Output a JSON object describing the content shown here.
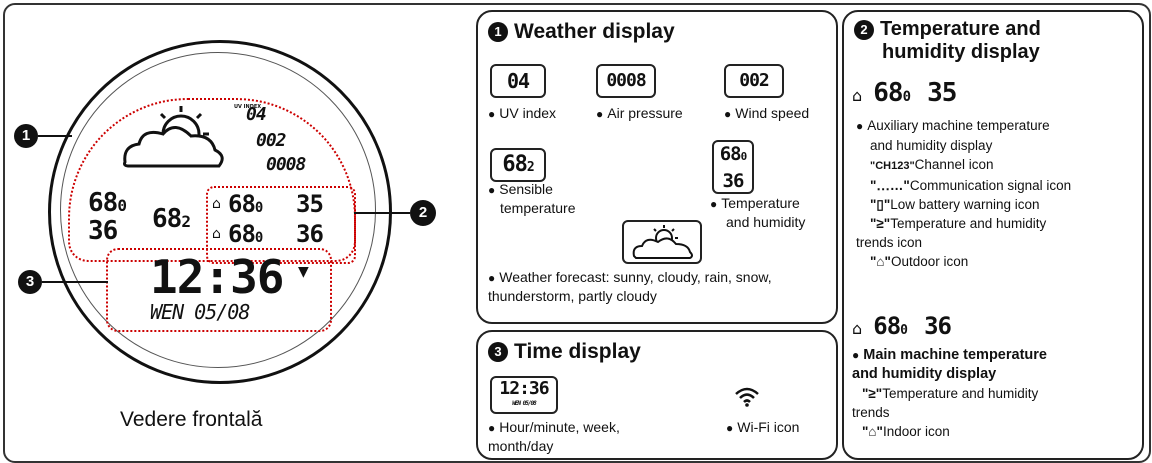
{
  "caption": "Vedere frontală",
  "callouts": [
    "1",
    "2",
    "3"
  ],
  "device": {
    "uv": "04",
    "pressure": "002",
    "wind": "0008",
    "indoor_temp_left": "68",
    "indoor_temp_left_dec": "0",
    "humidity_left": "36",
    "sensible": "68",
    "sensible_dec": "2",
    "ch_temp": "68",
    "ch_temp_dec": "0",
    "ch_hum": "35",
    "in_temp": "68",
    "in_temp_dec": "0",
    "in_hum": "36",
    "time": "12:36",
    "date": "WEN 05/08"
  },
  "weather_panel": {
    "number": "1",
    "title": "Weather display",
    "uv_value": "04",
    "pressure_value": "0008",
    "wind_value": "002",
    "uv_label": "UV index",
    "pressure_label": "Air pressure",
    "wind_label": "Wind speed",
    "sensible_value": "68",
    "sensible_dec": "2",
    "sensible_label_1": "Sensible",
    "sensible_label_2": "temperature",
    "th_temp": "68",
    "th_dec": "0",
    "th_hum": "36",
    "th_label_1": "Temperature",
    "th_label_2": "and humidity",
    "forecast_1": "Weather forecast: sunny, cloudy, rain, snow,",
    "forecast_2": "thunderstorm, partly cloudy"
  },
  "time_panel": {
    "number": "3",
    "title": "Time display",
    "time_value": "12:36",
    "date_value": "WEN 05/08",
    "label_1": "Hour/minute, week,",
    "label_2": "month/day",
    "wifi_label": "Wi-Fi icon"
  },
  "th_panel": {
    "number": "2",
    "title_1": "Temperature and",
    "title_2": "humidity display",
    "aux_temp": "68",
    "aux_dec": "0",
    "aux_hum": "35",
    "aux_1": "Auxiliary machine temperature",
    "aux_2": "and humidity display",
    "ch_icon": "\"CH123\"",
    "ch_text": "Channel icon",
    "signal_icon": "\"․‥…\"",
    "signal_text": "Communication signal icon",
    "battery_icon": "\"▯\"",
    "battery_text": "Low battery warning icon",
    "trend_icon": "\"≥\"",
    "trend_text_1": "Temperature and humidity",
    "trend_text_2": "trends icon",
    "outdoor_icon": "\"⌂\"",
    "outdoor_text": "Outdoor icon",
    "main_temp": "68",
    "main_dec": "0",
    "main_hum": "36",
    "main_1": "Main machine temperature",
    "main_2": "and humidity display",
    "main_trend_icon": "\"≥\"",
    "main_trend_1": "Temperature and humidity",
    "main_trend_2": "trends",
    "indoor_icon": "\"⌂\"",
    "indoor_text": "Indoor icon"
  }
}
